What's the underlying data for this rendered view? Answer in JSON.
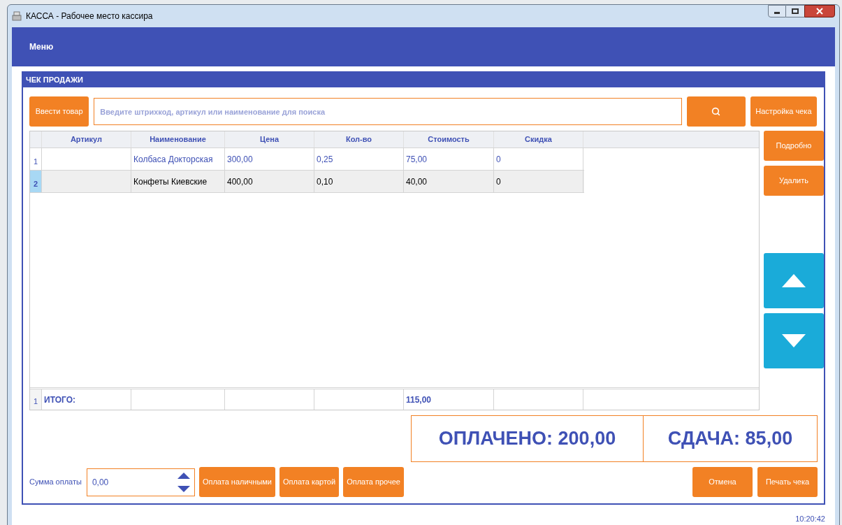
{
  "window": {
    "title": "КАССА - Рабочее место кассира"
  },
  "menu": {
    "label": "Меню"
  },
  "panel": {
    "title": "ЧЕК ПРОДАЖИ"
  },
  "toolbar": {
    "add_button": "Ввести товар",
    "search": {
      "placeholder": "Введите штрихкод, артикул или наименование для поиска"
    },
    "settings_button": "Настройка чека"
  },
  "table": {
    "columns": [
      "Артикул",
      "Наименование",
      "Цена",
      "Кол-во",
      "Стоимость",
      "Скидка"
    ],
    "rows": [
      {
        "number": "1",
        "cells": [
          "",
          "Колбаса Докторская",
          "300,00",
          "0,25",
          "75,00",
          "0"
        ],
        "selected": false
      },
      {
        "number": "2",
        "cells": [
          "",
          "Конфеты Киевские",
          "400,00",
          "0,10",
          "40,00",
          "0"
        ],
        "selected": true
      }
    ],
    "total_row": {
      "number": "1",
      "label": "ИТОГО:",
      "sum": "115,00"
    }
  },
  "side_buttons": [
    "Подробно",
    "Удалить"
  ],
  "summary": {
    "paid": "ОПЛАЧЕНО: 200,00",
    "change": "СДАЧА: 85,00"
  },
  "payment": {
    "label": "Сумма оплаты",
    "value": "0,00",
    "buttons": [
      "Оплата наличными",
      "Оплата картой",
      "Оплата прочее"
    ]
  },
  "actions": [
    "Отмена",
    "Печать чека"
  ],
  "status_bar": {
    "time": "10:20:42"
  }
}
